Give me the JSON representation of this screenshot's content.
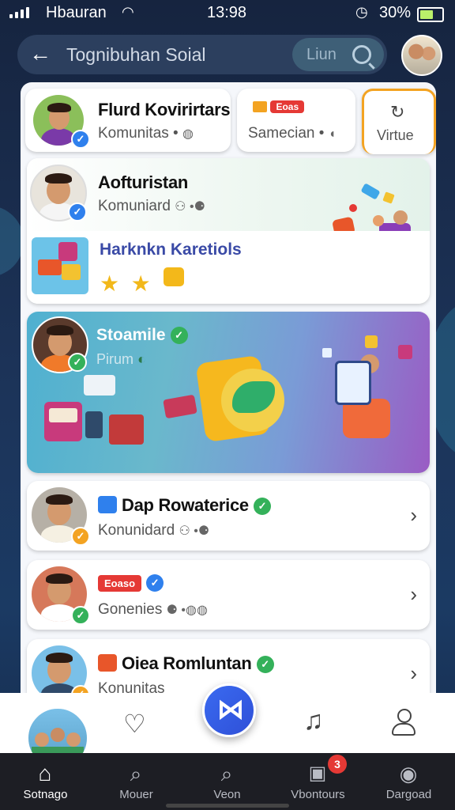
{
  "status_bar": {
    "carrier": "Hbauran",
    "time": "13:98",
    "battery_percent": "30%"
  },
  "header": {
    "title": "Tognibuhan Soial",
    "search_label": "Liun"
  },
  "cards": {
    "top_left": {
      "name": "Flurd Kovirirtars",
      "sub": "Komunitas •"
    },
    "top_mid": {
      "tag": "Eoas",
      "sub": "Samecian •"
    },
    "top_right": {
      "label": "Virtue"
    },
    "profile": {
      "name": "Aofturistan",
      "sub": "Komuniard"
    },
    "promo": {
      "title": "Harknkn Karetiols"
    },
    "banner": {
      "title": "Stoamile",
      "sub": "Pirum"
    },
    "list": [
      {
        "name": "Dap Rowaterice",
        "sub": "Konunidard"
      },
      {
        "tag": "Eoaso",
        "sub": "Gonenies"
      },
      {
        "name": "Oiea Romluntan",
        "sub": "Konunitas"
      }
    ]
  },
  "tabs": [
    {
      "label": "Sotnago"
    },
    {
      "label": "Mouer"
    },
    {
      "label": "Veon"
    },
    {
      "label": "Vbontours",
      "badge": "3"
    },
    {
      "label": "Dargoad"
    }
  ],
  "colors": {
    "accent": "#2f80ed",
    "verify_green": "#34b15a",
    "badge_red": "#e53935"
  }
}
